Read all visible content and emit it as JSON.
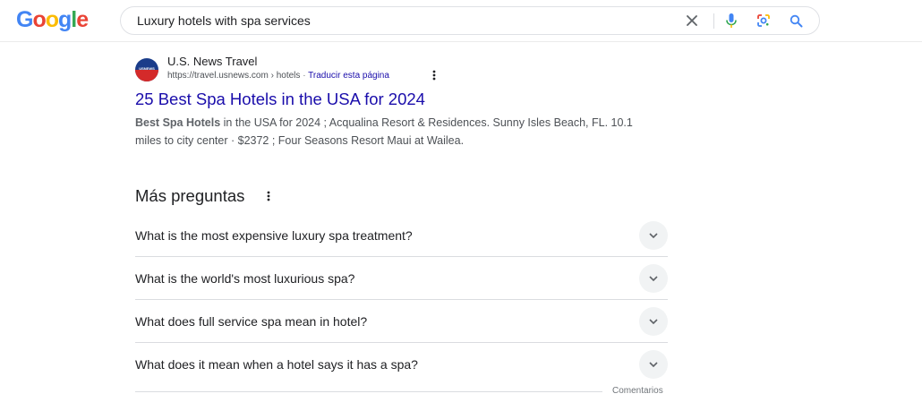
{
  "header": {
    "logo_text": "Google",
    "search": {
      "query": "Luxury hotels with spa services"
    },
    "icons": [
      "clear-icon",
      "microphone-icon",
      "lens-icon",
      "search-icon"
    ]
  },
  "result": {
    "site_name": "U.S. News Travel",
    "favicon_text": "USNEWS",
    "url": "https://travel.usnews.com › hotels",
    "url_separator": "·",
    "translate_label": "Traducir esta página",
    "title": "25 Best Spa Hotels in the USA for 2024",
    "snippet": {
      "bold_prefix": "Best Spa Hotels",
      "text": " in the USA for 2024 ; Acqualina Resort & Residences. Sunny Isles Beach, FL. 10.1 miles to city center · $2372 ; Four Seasons Resort Maui at Wailea."
    }
  },
  "paa": {
    "heading": "Más preguntas",
    "questions": [
      "What is the most expensive luxury spa treatment?",
      "What is the world's most luxurious spa?",
      "What does full service spa mean in hotel?",
      "What does it mean when a hotel says it has a spa?"
    ],
    "feedback_label": "Comentarios"
  },
  "colors": {
    "link": "#1a0dab",
    "text": "#202124",
    "secondary": "#4d5156",
    "google_blue": "#4285f4",
    "google_red": "#ea4335",
    "google_yellow": "#fbbc05",
    "google_green": "#34a853"
  }
}
